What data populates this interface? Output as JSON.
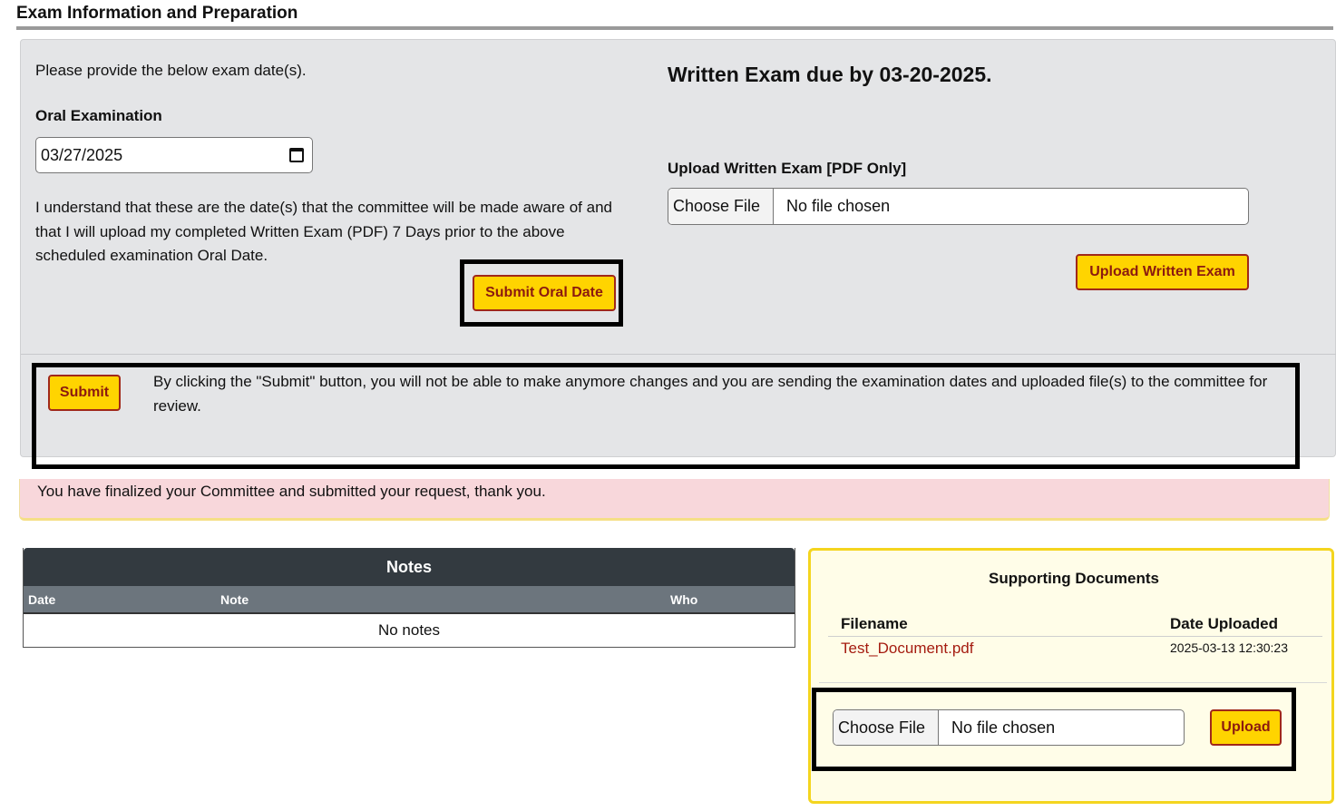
{
  "page": {
    "title": "Exam Information and Preparation"
  },
  "exam": {
    "intro": "Please provide the below exam date(s).",
    "oral_label": "Oral Examination",
    "oral_date": "03/27/2025",
    "acknowledgement": "I understand that these are the date(s) that the committee will be made aware of and that I will upload my completed Written Exam (PDF) 7 Days prior to the above scheduled examination Oral Date.",
    "submit_oral_label": "Submit Oral Date",
    "written_due": "Written Exam due by 03-20-2025.",
    "upload_label": "Upload Written Exam [PDF Only]",
    "choose_file": "Choose File",
    "no_file": "No file chosen",
    "upload_written_label": "Upload Written Exam"
  },
  "final_submit": {
    "button_label": "Submit",
    "text": "By clicking the \"Submit\" button, you will not be able to make anymore changes and you are sending the examination dates and uploaded file(s) to the committee for review."
  },
  "alert": {
    "text": "You have finalized your Committee and submitted your request, thank you."
  },
  "notes": {
    "title": "Notes",
    "columns": [
      "Date",
      "Note",
      "Who"
    ],
    "empty": "No notes"
  },
  "documents": {
    "title": "Supporting Documents",
    "columns": [
      "Filename",
      "Date Uploaded"
    ],
    "rows": [
      {
        "filename": "Test_Document.pdf",
        "date": "2025-03-13 12:30:23"
      }
    ],
    "choose_file": "Choose File",
    "no_file": "No file chosen",
    "upload_label": "Upload"
  },
  "colors": {
    "button_bg": "#ffd400",
    "button_text": "#8b1a10",
    "panel_bg": "#e4e5e7",
    "alert_bg": "#f8d7db",
    "docs_border": "#f4d51e",
    "notes_header": "#333a40"
  }
}
